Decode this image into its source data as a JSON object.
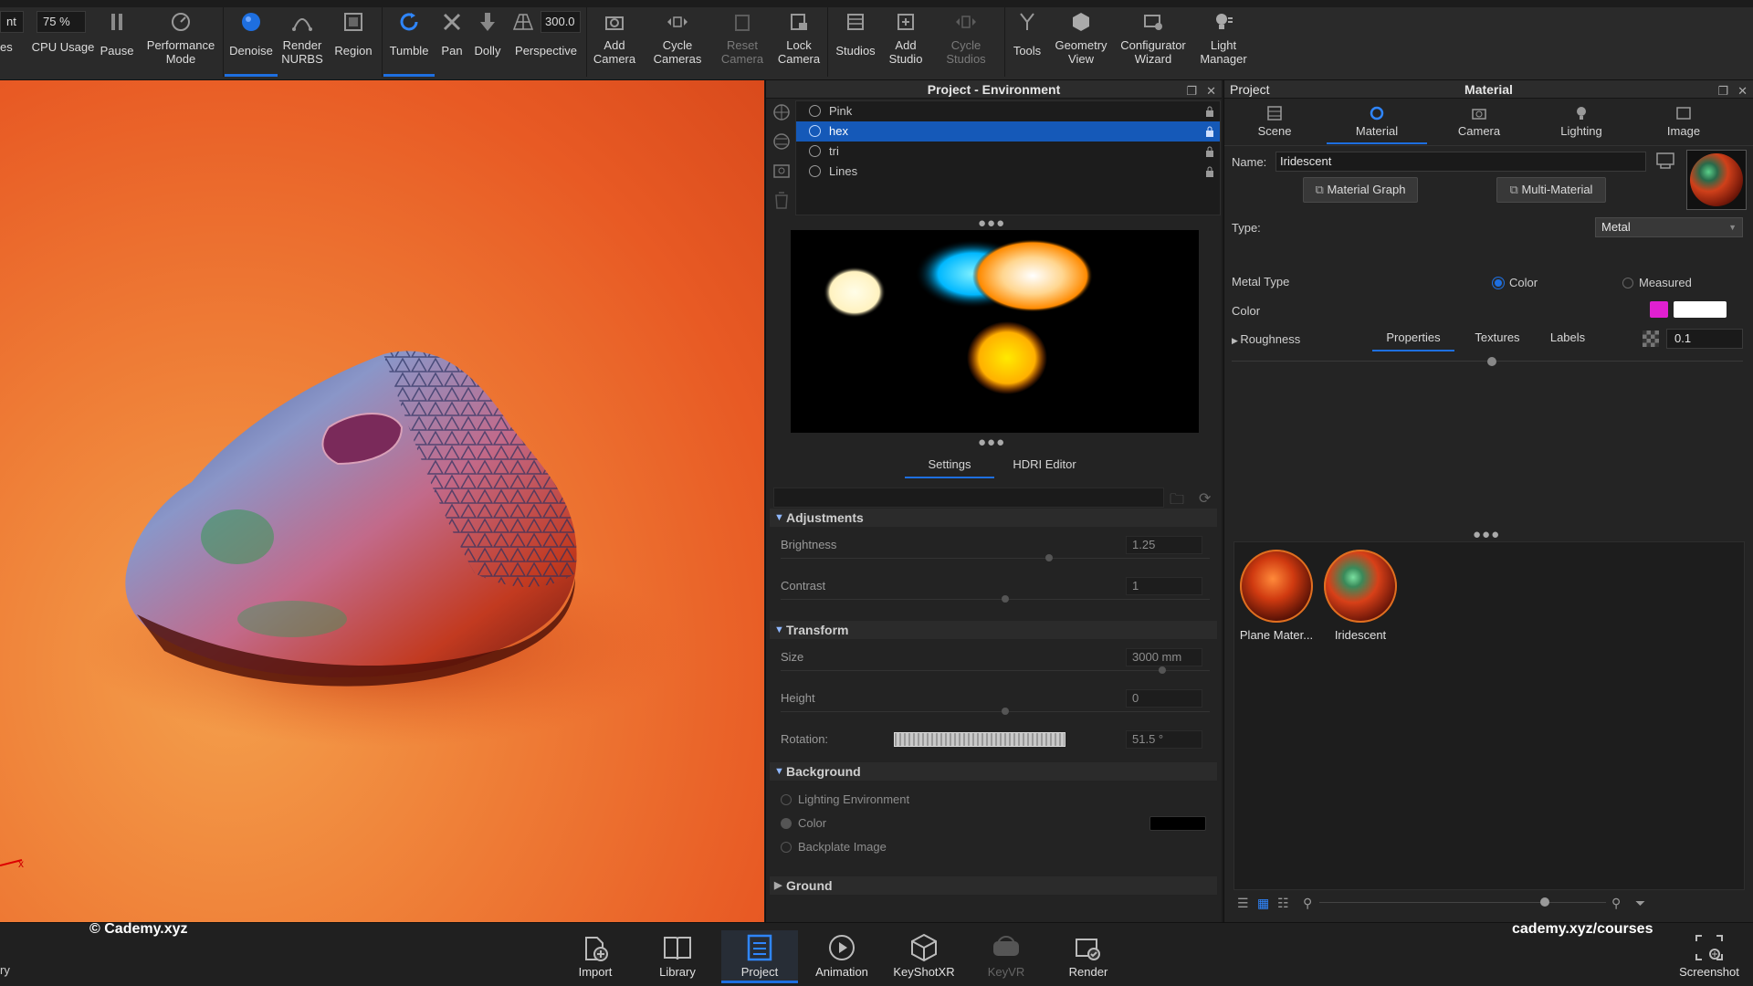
{
  "toolbar": {
    "left_partial": "nt",
    "left_partial2": "es",
    "zoom_value": "75 %",
    "perspective_value": "300.0",
    "items": {
      "cpu": "CPU Usage",
      "pause": "Pause",
      "performance": "Performance\nMode",
      "denoise": "Denoise",
      "render_nurbs": "Render\nNURBS",
      "region": "Region",
      "tumble": "Tumble",
      "pan": "Pan",
      "dolly": "Dolly",
      "perspective": "Perspective",
      "add_camera": "Add\nCamera",
      "cycle_cameras": "Cycle\nCameras",
      "reset_camera": "Reset\nCamera",
      "lock_camera": "Lock\nCamera",
      "studios": "Studios",
      "add_studio": "Add\nStudio",
      "cycle_studios": "Cycle\nStudios",
      "tools": "Tools",
      "geometry_view": "Geometry\nView",
      "configurator": "Configurator\nWizard",
      "light_manager": "Light\nManager"
    }
  },
  "environment": {
    "title": "Project - Environment",
    "list": [
      "Pink",
      "hex",
      "tri",
      "Lines"
    ],
    "selected": "hex",
    "tabs": [
      "Settings",
      "HDRI Editor"
    ],
    "active_tab": "Settings",
    "sections": {
      "adjustments": "Adjustments",
      "transform": "Transform",
      "background": "Background",
      "ground": "Ground"
    },
    "brightness": {
      "label": "Brightness",
      "value": "1.25"
    },
    "contrast": {
      "label": "Contrast",
      "value": "1"
    },
    "size": {
      "label": "Size",
      "value": "3000 mm"
    },
    "height": {
      "label": "Height",
      "value": "0"
    },
    "rotation": {
      "label": "Rotation:",
      "value": "51.5 °"
    },
    "background_options": [
      "Lighting Environment",
      "Color",
      "Backplate Image"
    ],
    "background_selected": "Color",
    "background_color": "#000000"
  },
  "material_panel": {
    "left_title": "Project",
    "title": "Material",
    "tabs": [
      "Scene",
      "Material",
      "Camera",
      "Lighting",
      "Image"
    ],
    "active_tab": "Material",
    "name_label": "Name:",
    "name_value": "Iridescent",
    "material_graph": "Material Graph",
    "multi_material": "Multi-Material",
    "type_label": "Type:",
    "type_value": "Metal",
    "subtabs": [
      "Properties",
      "Textures",
      "Labels"
    ],
    "active_subtab": "Properties",
    "metal_type_label": "Metal Type",
    "metal_type_options": [
      "Color",
      "Measured"
    ],
    "metal_type_selected": "Color",
    "color_label": "Color",
    "color_swatch_1": "#e020d0",
    "color_swatch_2": "#ffffff",
    "roughness_label": "Roughness",
    "roughness_value": "0.1",
    "roughness_level": 0.1,
    "library": [
      "Plane Mater...",
      "Iridescent"
    ]
  },
  "bottom": {
    "items": [
      "Import",
      "Library",
      "Project",
      "Animation",
      "KeyShotXR",
      "KeyVR",
      "Render"
    ],
    "active": "Project",
    "screenshot": "Screenshot",
    "left_partial": "ry",
    "watermark_left": "© Cademy.xyz",
    "watermark_right": "cademy.xyz/courses"
  },
  "colors": {
    "accent": "#1e6fe0",
    "selection": "#1559b8",
    "viewport_bg": "#e85a24"
  }
}
